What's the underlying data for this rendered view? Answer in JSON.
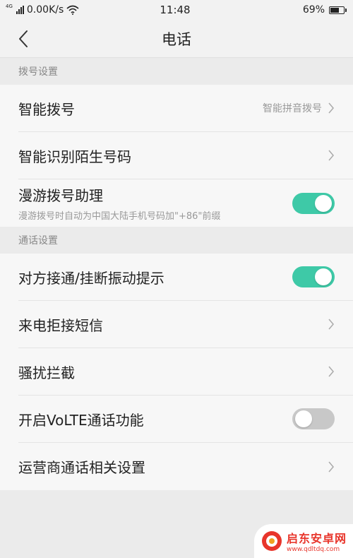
{
  "status_bar": {
    "network_type": "4G",
    "speed": "0.00K/s",
    "time": "11:48",
    "battery_percent": "69%",
    "battery_level": 0.69
  },
  "header": {
    "title": "电话"
  },
  "sections": [
    {
      "title": "拨号设置",
      "items": [
        {
          "title": "智能拨号",
          "value": "智能拼音拨号"
        },
        {
          "title": "智能识别陌生号码"
        },
        {
          "title": "漫游拨号助理",
          "subtitle": "漫游拨号时自动为中国大陆手机号码加\"+86\"前缀",
          "toggle": "on"
        }
      ]
    },
    {
      "title": "通话设置",
      "items": [
        {
          "title": "对方接通/挂断振动提示",
          "toggle": "on"
        },
        {
          "title": "来电拒接短信"
        },
        {
          "title": "骚扰拦截"
        },
        {
          "title": "开启VoLTE通话功能",
          "toggle": "off"
        },
        {
          "title": "运营商通话相关设置"
        }
      ]
    }
  ],
  "watermark": {
    "name": "启东安卓网",
    "url": "www.qdltdq.com"
  },
  "colors": {
    "toggle_on": "#3ec9a7",
    "toggle_off": "#c8c8c8",
    "watermark": "#e8352b"
  }
}
